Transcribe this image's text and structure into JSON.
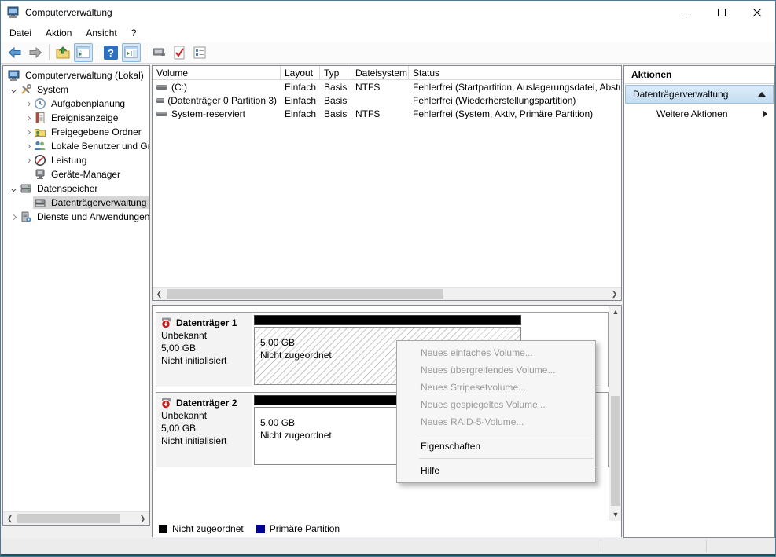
{
  "window": {
    "title": "Computerverwaltung"
  },
  "menu": {
    "items": [
      "Datei",
      "Aktion",
      "Ansicht",
      "?"
    ]
  },
  "toolbar": {
    "help_glyph": "?"
  },
  "tree": {
    "root": {
      "label": "Computerverwaltung (Lokal)"
    },
    "items": [
      {
        "label": "System"
      },
      {
        "label": "Aufgabenplanung"
      },
      {
        "label": "Ereignisanzeige"
      },
      {
        "label": "Freigegebene Ordner"
      },
      {
        "label": "Lokale Benutzer und Gru"
      },
      {
        "label": "Leistung"
      },
      {
        "label": "Geräte-Manager"
      },
      {
        "label": "Datenspeicher"
      },
      {
        "label": "Datenträgerverwaltung"
      },
      {
        "label": "Dienste und Anwendungen"
      }
    ]
  },
  "volume_table": {
    "columns": [
      "Volume",
      "Layout",
      "Typ",
      "Dateisystem",
      "Status"
    ],
    "rows": [
      {
        "volume": "(C:)",
        "layout": "Einfach",
        "typ": "Basis",
        "dateisystem": "NTFS",
        "status": "Fehlerfrei (Startpartition, Auslagerungsdatei, Abstu"
      },
      {
        "volume": "(Datenträger 0 Partition 3)",
        "layout": "Einfach",
        "typ": "Basis",
        "dateisystem": "",
        "status": "Fehlerfrei (Wiederherstellungspartition)"
      },
      {
        "volume": "System-reserviert",
        "layout": "Einfach",
        "typ": "Basis",
        "dateisystem": "NTFS",
        "status": "Fehlerfrei (System, Aktiv, Primäre Partition)"
      }
    ]
  },
  "disks": [
    {
      "name": "Datenträger 1",
      "type": "Unbekannt",
      "size": "5,00 GB",
      "state": "Nicht initialisiert",
      "partition_size": "5,00 GB",
      "partition_label": "Nicht zugeordnet"
    },
    {
      "name": "Datenträger 2",
      "type": "Unbekannt",
      "size": "5,00 GB",
      "state": "Nicht initialisiert",
      "partition_size": "5,00 GB",
      "partition_label": "Nicht zugeordnet"
    }
  ],
  "context_menu": {
    "items": [
      {
        "label": "Neues einfaches Volume...",
        "enabled": false
      },
      {
        "label": "Neues übergreifendes Volume...",
        "enabled": false
      },
      {
        "label": "Neues Stripesetvolume...",
        "enabled": false
      },
      {
        "label": "Neues gespiegeltes Volume...",
        "enabled": false
      },
      {
        "label": "Neues RAID-5-Volume...",
        "enabled": false
      },
      {
        "label": "Eigenschaften",
        "enabled": true
      },
      {
        "label": "Hilfe",
        "enabled": true
      }
    ]
  },
  "actions": {
    "header": "Aktionen",
    "group_label": "Datenträgerverwaltung",
    "item_label": "Weitere Aktionen"
  },
  "legend": [
    {
      "label": "Nicht zugeordnet",
      "color": "#000000"
    },
    {
      "label": "Primäre Partition",
      "color": "#000099"
    }
  ],
  "colors": {
    "accent_bottom": "#1a525e",
    "selection_gray": "#d6d6d6",
    "action_selected": "#c3ddf1"
  }
}
